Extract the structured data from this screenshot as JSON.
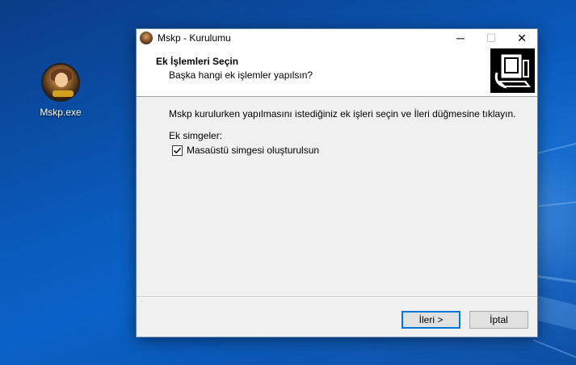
{
  "desktop": {
    "icons": [
      {
        "label": "Mskp.exe",
        "icon": "game-character-icon"
      }
    ]
  },
  "window": {
    "title": "Mskp - Kurulumu",
    "controls": {
      "minimize": "─",
      "maximize": "☐",
      "close": "✕"
    },
    "header": {
      "title": "Ek İşlemleri Seçin",
      "subtitle": "Başka hangi ek işlemler yapılsın?",
      "image": "installer-computer-icon"
    },
    "content": {
      "description": "Mskp kurulurken yapılmasını istediğiniz ek işleri seçin ve İleri düğmesine tıklayın.",
      "group_label": "Ek simgeler:",
      "checkboxes": [
        {
          "label": "Masaüstü simgesi oluşturulsun",
          "checked": true
        }
      ]
    },
    "buttons": {
      "next": "İleri >",
      "cancel": "İptal"
    }
  },
  "colors": {
    "accent": "#0078d7",
    "dialog_bg": "#f0f0f0",
    "desktop_bg": "#0a5bbd"
  }
}
